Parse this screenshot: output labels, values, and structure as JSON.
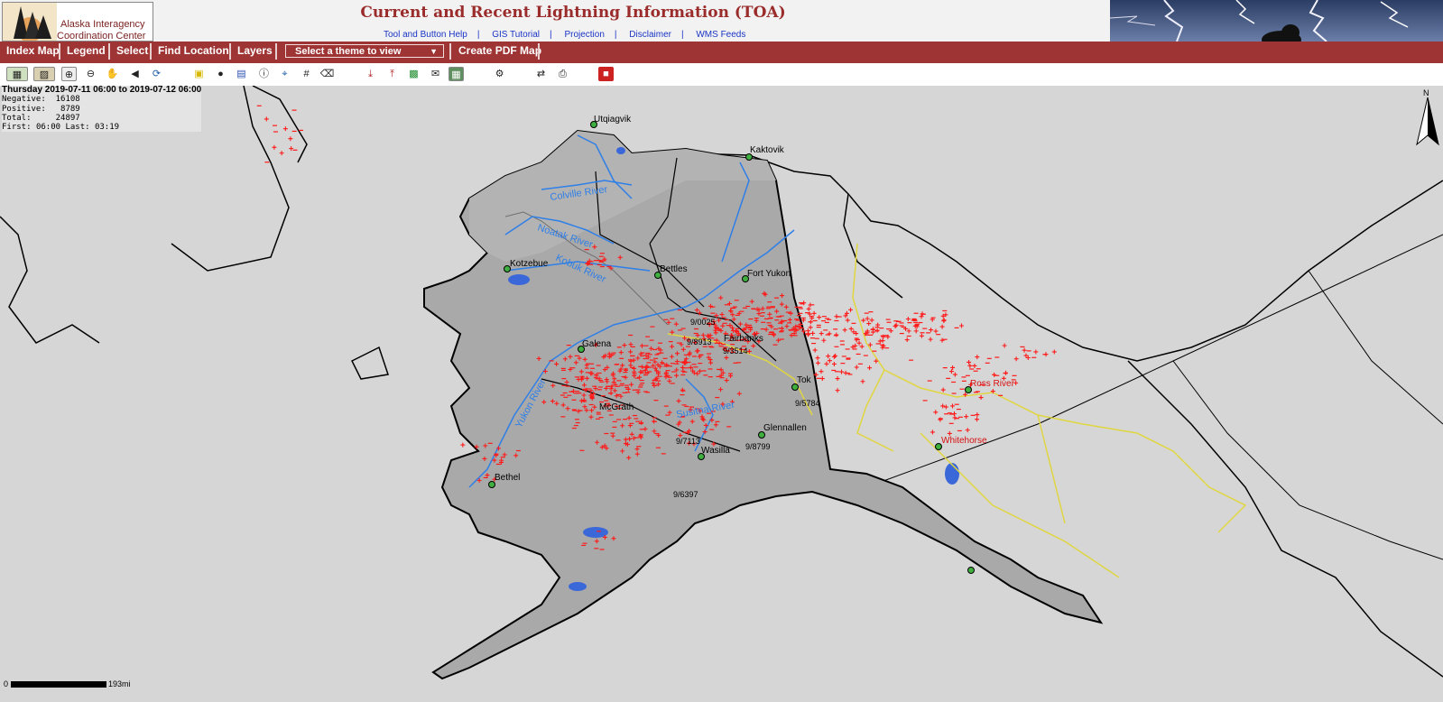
{
  "header": {
    "logo_line1": "Alaska Interagency",
    "logo_line2": "Coordination Center",
    "title": "Current and Recent Lightning Information (TOA)",
    "links": [
      "Tool and Button Help",
      "GIS Tutorial",
      "Projection",
      "Disclaimer",
      "WMS Feeds"
    ]
  },
  "menubar": {
    "items": [
      "Index Map",
      "Legend",
      "Select",
      "Find Location",
      "Layers"
    ],
    "theme_select": "Select a theme to view",
    "pdf_button": "Create PDF Map"
  },
  "toolbar": {
    "tools": [
      "overview-map-icon",
      "full-extent-icon",
      "zoom-in-icon",
      "zoom-out-icon",
      "pan-hand-icon",
      "back-extent-icon",
      "refresh-icon",
      "select-rectangle-icon",
      "identify-icon",
      "layer-list-icon",
      "info-icon",
      "locate-icon",
      "grid-icon",
      "eraser-icon",
      "download-icon",
      "upload-icon",
      "export-excel-icon",
      "email-icon",
      "table-icon",
      "settings-icon",
      "measure-icon",
      "print-icon",
      "trash-icon"
    ]
  },
  "stats": {
    "header": "Thursday 2019-07-11 06:00 to 2019-07-12 06:00",
    "negative_label": "Negative:",
    "negative": "16108",
    "positive_label": "Positive:",
    "positive": "8789",
    "total_label": "Total:",
    "total": "24897",
    "first_label": "First:",
    "first": "06:00",
    "last_label": "Last:",
    "last": "03:19"
  },
  "map": {
    "places": [
      "Utqiagvik",
      "Kaktovik",
      "Kotzebue",
      "Bettles",
      "Fort Yukon",
      "Galena",
      "Fairbanks",
      "Tok",
      "McGrath",
      "Glennallen",
      "Wasilla",
      "Bethel",
      "Whitehorse",
      "Ross River"
    ],
    "rivers": [
      "Colville River",
      "Noatak River",
      "Kobuk River",
      "Yukon River",
      "Susitna River"
    ],
    "fire_labels": [
      "9/0025",
      "9/8913",
      "9/3514",
      "9/5784",
      "9/7113",
      "9/8799",
      "9/6397"
    ],
    "north_arrow": "N",
    "colors": {
      "land": "#a9a9a9",
      "water": "#d6d6d6",
      "lightning": "#ff1a1a",
      "river": "#2f7fe8",
      "road": "#e0d640"
    }
  },
  "scalebar": {
    "zero": "0",
    "max": "193mi"
  }
}
